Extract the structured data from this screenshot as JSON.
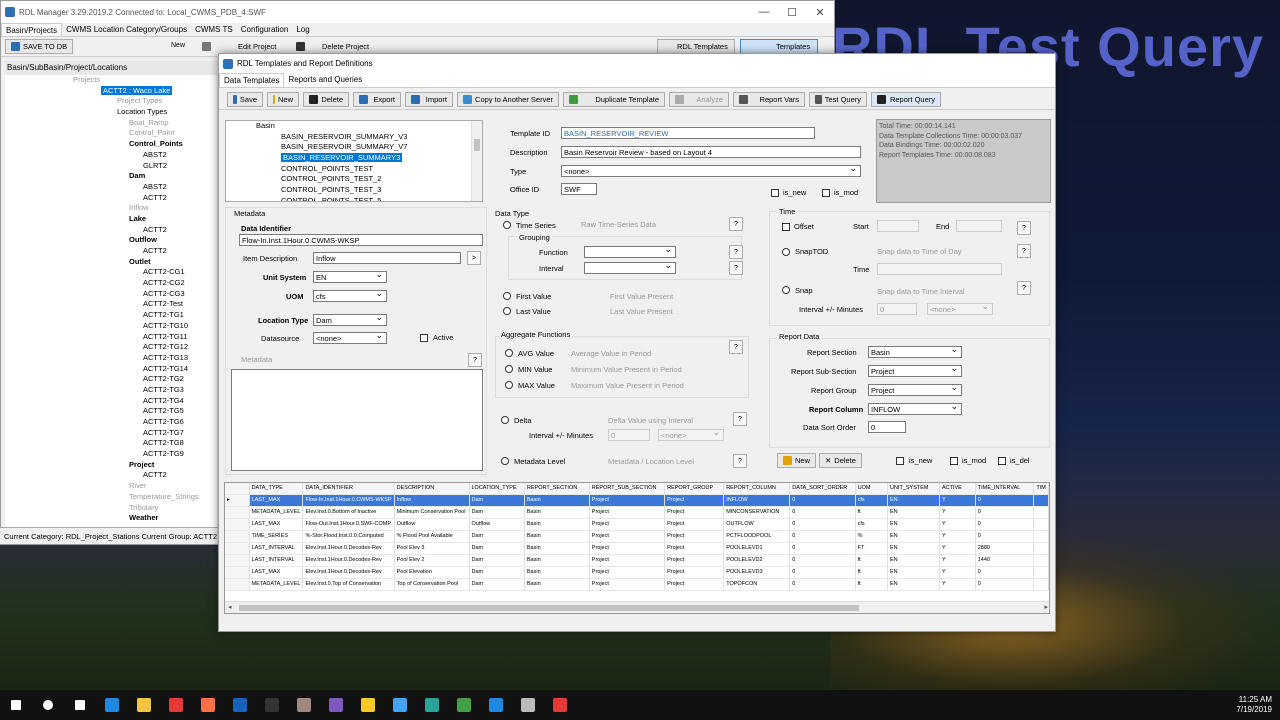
{
  "overlay_title": "RDL Test Query",
  "main_window": {
    "title": "RDL Manager 3.29.2019.2   Connected to: Local_CWMS_PDB_4:SWF",
    "menu": [
      "Basin/Projects",
      "CWMS Location Category/Groups",
      "CWMS TS",
      "Configuration",
      "Log"
    ],
    "toolbar": {
      "save_to_db": "SAVE TO DB",
      "new": "New",
      "edit_project": "Edit Project",
      "delete_project": "Delete Project",
      "rdl_templates": "RDL Templates",
      "templates": "Templates"
    },
    "breadcrumb": "Basin/SubBasin/Project/Locations",
    "tree": [
      {
        "text": "Projects",
        "indent": 68,
        "style": "gray"
      },
      {
        "text": "ACTT2 : Waco Lake",
        "indent": 96,
        "style": "hl"
      },
      {
        "text": "Project Types",
        "indent": 112,
        "style": "gray"
      },
      {
        "text": "Location Types",
        "indent": 112,
        "style": ""
      },
      {
        "text": "Boat_Ramp",
        "indent": 124,
        "style": "gray"
      },
      {
        "text": "Control_Point",
        "indent": 124,
        "style": "gray"
      },
      {
        "text": "Control_Points",
        "indent": 124,
        "style": "b"
      },
      {
        "text": "ABST2",
        "indent": 138,
        "style": ""
      },
      {
        "text": "GLRT2",
        "indent": 138,
        "style": ""
      },
      {
        "text": "Dam",
        "indent": 124,
        "style": "b"
      },
      {
        "text": "ABST2",
        "indent": 138,
        "style": ""
      },
      {
        "text": "ACTT2",
        "indent": 138,
        "style": ""
      },
      {
        "text": "Inflow",
        "indent": 124,
        "style": "gray"
      },
      {
        "text": "Lake",
        "indent": 124,
        "style": "b"
      },
      {
        "text": "ACTT2",
        "indent": 138,
        "style": ""
      },
      {
        "text": "Outflow",
        "indent": 124,
        "style": "b"
      },
      {
        "text": "ACTT2",
        "indent": 138,
        "style": ""
      },
      {
        "text": "Outlet",
        "indent": 124,
        "style": "b"
      },
      {
        "text": "ACTT2-CG1",
        "indent": 138,
        "style": ""
      },
      {
        "text": "ACTT2-CG2",
        "indent": 138,
        "style": ""
      },
      {
        "text": "ACTT2-CG3",
        "indent": 138,
        "style": ""
      },
      {
        "text": "ACTT2-Test",
        "indent": 138,
        "style": ""
      },
      {
        "text": "ACTT2-TG1",
        "indent": 138,
        "style": ""
      },
      {
        "text": "ACTT2-TG10",
        "indent": 138,
        "style": ""
      },
      {
        "text": "ACTT2-TG11",
        "indent": 138,
        "style": ""
      },
      {
        "text": "ACTT2-TG12",
        "indent": 138,
        "style": ""
      },
      {
        "text": "ACTT2-TG13",
        "indent": 138,
        "style": ""
      },
      {
        "text": "ACTT2-TG14",
        "indent": 138,
        "style": ""
      },
      {
        "text": "ACTT2-TG2",
        "indent": 138,
        "style": ""
      },
      {
        "text": "ACTT2-TG3",
        "indent": 138,
        "style": ""
      },
      {
        "text": "ACTT2-TG4",
        "indent": 138,
        "style": ""
      },
      {
        "text": "ACTT2-TG5",
        "indent": 138,
        "style": ""
      },
      {
        "text": "ACTT2-TG6",
        "indent": 138,
        "style": ""
      },
      {
        "text": "ACTT2-TG7",
        "indent": 138,
        "style": ""
      },
      {
        "text": "ACTT2-TG8",
        "indent": 138,
        "style": ""
      },
      {
        "text": "ACTT2-TG9",
        "indent": 138,
        "style": ""
      },
      {
        "text": "Project",
        "indent": 124,
        "style": "b"
      },
      {
        "text": "ACTT2",
        "indent": 138,
        "style": ""
      },
      {
        "text": "River",
        "indent": 124,
        "style": "gray"
      },
      {
        "text": "Temperature_Strings",
        "indent": 124,
        "style": "gray"
      },
      {
        "text": "Tributary",
        "indent": 124,
        "style": "gray"
      },
      {
        "text": "Weather",
        "indent": 124,
        "style": "b"
      }
    ],
    "status": "Current Category: RDL_Project_Stations   Current Group: ACTT2"
  },
  "dialog": {
    "title": "RDL Templates and Report Definitions",
    "tabs": [
      "Data Templates",
      "Reports and Queries"
    ],
    "toolbar": [
      "Save",
      "New",
      "Delete",
      "Export",
      "Import",
      "Copy to Another Server",
      "Duplicate Template",
      "Analyze",
      "Report Vars",
      "Test Query",
      "Report Query"
    ],
    "toolbar_icons": [
      "#2a6db5",
      "#e0a500",
      "#222",
      "#2a6db5",
      "#2a6db5",
      "#3b8ed3",
      "#3d9a3d",
      "#aaa",
      "#555",
      "#555",
      "#222"
    ],
    "template_tree": [
      {
        "text": "Basin",
        "indent": 30,
        "sel": false
      },
      {
        "text": "BASIN_RESERVOIR_SUMMARY_V3",
        "indent": 55,
        "sel": false
      },
      {
        "text": "BASIN_RESERVOIR_SUMMARY_V7",
        "indent": 55,
        "sel": false
      },
      {
        "text": "BASIN_RESERVOIR_SUMMARY3",
        "indent": 55,
        "sel": true
      },
      {
        "text": "CONTROL_POINTS_TEST",
        "indent": 55,
        "sel": false
      },
      {
        "text": "CONTROL_POINTS_TEST_2",
        "indent": 55,
        "sel": false
      },
      {
        "text": "CONTROL_POINTS_TEST_3",
        "indent": 55,
        "sel": false
      },
      {
        "text": "CONTROL_POINTS_TEST_5",
        "indent": 55,
        "sel": false
      }
    ],
    "template": {
      "template_id_label": "Template ID",
      "template_id": "BASIN_RESERVOIR_REVIEW",
      "description_label": "Description",
      "description": "Basin Reservoir Review - based on Layout 4",
      "type_label": "Type",
      "type": "<none>",
      "office_label": "Office ID",
      "office": "SWF",
      "is_new": "is_new",
      "is_mod": "is_mod"
    },
    "timing": [
      "Total Time: 00:00:14.141",
      "Data Template Collections Time: 00:00:03.037",
      "Data Bindings Time: 00:00:02.020",
      "Report Templates Time: 00:00:08.083"
    ],
    "metadata": {
      "header": "Metadata",
      "data_identifier_label": "Data Identifier",
      "data_identifier": "Flow-In.Inst.1Hour.0.CWMS-WKSP",
      "item_desc_label": "Item Description",
      "item_desc": "Inflow",
      "unit_system_label": "Unit System",
      "unit_system": "EN",
      "uom_label": "UOM",
      "uom": "cfs",
      "location_type_label": "Location Type",
      "location_type": "Dam",
      "datasource_label": "Datasource",
      "datasource": "<none>",
      "active_label": "Active",
      "metadata_label": "Metadata"
    },
    "datatype": {
      "header": "Data Type",
      "time_series": "Time Series",
      "time_series_desc": "Raw Time-Series Data",
      "grouping": "Grouping",
      "function": "Function",
      "interval": "Interval",
      "first_value": "First Value",
      "first_desc": "First Value Present",
      "last_value": "Last Value",
      "last_desc": "Last Value Present",
      "agg_header": "Aggregate Functions",
      "avg": "AVG Value",
      "avg_desc": "Average Value in Period",
      "min": "MIN Value",
      "min_desc": "Minimum Value Present  in Period",
      "max": "MAX Value",
      "max_desc": "Maximum Value Present in Period",
      "delta": "Delta",
      "delta_desc": "Delta Value using Interval",
      "delta_interval": "Interval +/- Minutes",
      "delta_interval_val": "0",
      "delta_unit": "<none>",
      "metadata_level": "Metadata Level",
      "metadata_level_desc": "Metadata / Location Level"
    },
    "time": {
      "header": "Time",
      "offset": "Offset",
      "start": "Start",
      "end": "End",
      "snaptod": "SnapTOD",
      "snaptod_desc": "Snap data to Time of Day",
      "time": "Time",
      "snap": "Snap",
      "snap_desc": "Snap data to Time Interval",
      "interval": "Interval +/- Minutes",
      "interval_val": "0",
      "interval_unit": "<none>"
    },
    "report": {
      "header": "Report Data",
      "section_label": "Report Section",
      "section": "Basin",
      "subsection_label": "Report Sub-Section",
      "subsection": "Project",
      "group_label": "Report Group",
      "group": "Project",
      "column_label": "Report Column",
      "column": "INFLOW",
      "sort_label": "Data Sort Order",
      "sort": "0",
      "new": "New",
      "delete": "Delete",
      "is_new": "is_new",
      "is_mod": "is_mod",
      "is_del": "is_del"
    },
    "grid": {
      "columns": [
        "DATA_TYPE",
        "DATA_IDENTIFIER",
        "DESCRIPTION",
        "LOCATION_TYPE",
        "REPORT_SECTION",
        "REPORT_SUB_SECTION",
        "REPORT_GROUP",
        "REPORT_COLUMN",
        "DATA_SORT_ORDER",
        "UOM",
        "UNIT_SYSTEM",
        "ACTIVE",
        "TIME_INTERVAL",
        "TIM"
      ],
      "rows": [
        [
          "LAST_MAX",
          "Flow-In.Inst.1Hour.0.CWMS-WKSP",
          "Inflow",
          "Dam",
          "Basin",
          "Project",
          "Project",
          "INFLOW",
          "0",
          "cfs",
          "EN",
          "Y",
          "0",
          ""
        ],
        [
          "METADATA_LEVEL",
          "Elev.Inst.0.Bottom of Inactive",
          "Minimum Conservation Pool",
          "Dam",
          "Basin",
          "Project",
          "Project",
          "MINCONSERVATION",
          "0",
          "ft",
          "EN",
          "Y",
          "0",
          ""
        ],
        [
          "LAST_MAX",
          "Flow-Out.Inst.1Hour.0.SWF-COMP",
          "Outflow",
          "Outflow",
          "Basin",
          "Project",
          "Project",
          "OUTFLOW",
          "0",
          "cfs",
          "EN",
          "Y",
          "0",
          ""
        ],
        [
          "TIME_SERIES",
          "%-Stor.Flood.Inst.0.0.Computed",
          "% Flood Pool Available",
          "Dam",
          "Basin",
          "Project",
          "Project",
          "PCTFLOODPOOL",
          "0",
          "%",
          "EN",
          "Y",
          "0",
          ""
        ],
        [
          "LAST_INTERVAL",
          "Elev.Inst.1Hour.0.Decodes-Rev",
          "Pool Elev 3",
          "Dam",
          "Basin",
          "Project",
          "Project",
          "POOLELEVD1",
          "0",
          "FT",
          "EN",
          "Y",
          "2880",
          ""
        ],
        [
          "LAST_INTERVAL",
          "Elev.Inst.1Hour.0.Decodes-Rev",
          "Pool Elev 2",
          "Dam",
          "Basin",
          "Project",
          "Project",
          "POOLELEVD2",
          "0",
          "ft",
          "EN",
          "Y",
          "1440",
          ""
        ],
        [
          "LAST_MAX",
          "Elev.Inst.1Hour.0.Decodes-Rev",
          "Pool Elevation",
          "Dam",
          "Basin",
          "Project",
          "Project",
          "POOLELEVD3",
          "0",
          "ft",
          "EN",
          "Y",
          "0",
          ""
        ],
        [
          "METADATA_LEVEL",
          "Elev.Inst.0.Top of Conservation",
          "Top of Conservation Pool",
          "Dam",
          "Basin",
          "Project",
          "Project",
          "TOPOFCON",
          "0",
          "ft",
          "EN",
          "Y",
          "0",
          ""
        ]
      ]
    }
  },
  "taskbar": {
    "icons": [
      "windows-icon",
      "search-icon",
      "task-view-icon",
      "edge-icon",
      "file-explorer-icon",
      "chrome-icon",
      "firefox-icon",
      "firefox-dev-icon",
      "terminal-icon",
      "app-icon",
      "visual-studio-icon",
      "star-app-icon",
      "network-icon",
      "app-icon-2",
      "excel-like-icon",
      "ws-icon",
      "rdl-app-icon",
      "s-app-icon"
    ],
    "time": "11:25 AM",
    "date": "7/19/2019"
  }
}
